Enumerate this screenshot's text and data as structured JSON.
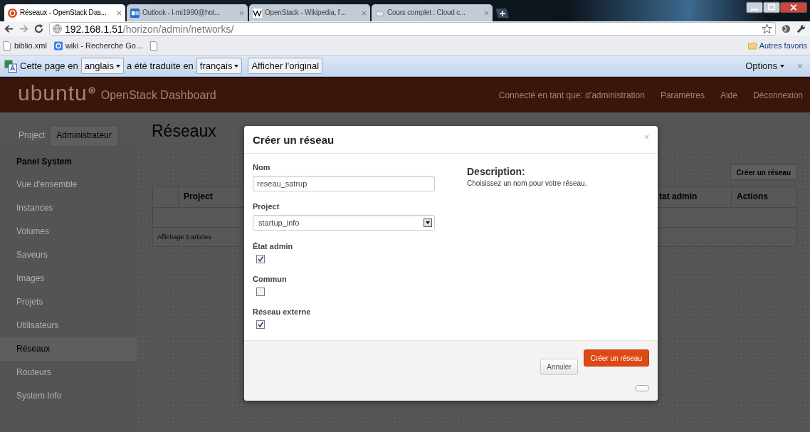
{
  "browser": {
    "tabs": [
      {
        "title": "Réseaux - OpenStack Das...",
        "selected": true
      },
      {
        "title": "Outlook - l-mi1990@hot...",
        "selected": false
      },
      {
        "title": "OpenStack - Wikipedia, l'...",
        "selected": false
      },
      {
        "title": "Cours complet : Cloud c...",
        "selected": false
      }
    ],
    "url_host": "192.168.1.51",
    "url_path": "/horizon/admin/networks/",
    "bookmarks": [
      {
        "label": "biblio.xml"
      },
      {
        "label": "wiki - Recherche Go..."
      }
    ],
    "other_bookmarks": "Autres favoris"
  },
  "translate_bar": {
    "prefix": "Cette page en",
    "source_language": "anglais",
    "middle": "a été traduite en",
    "target_language": "français",
    "show_original": "Afficher l'original",
    "options": "Options"
  },
  "header": {
    "logo": "ubuntu",
    "product": "OpenStack Dashboard",
    "nav": [
      "Connecté en tant que: d'administration",
      "Paramètres",
      "Aide",
      "Déconnexion"
    ]
  },
  "sidebar": {
    "tabs": [
      {
        "label": "Project",
        "selected": false
      },
      {
        "label": "Administrateur",
        "selected": true
      }
    ],
    "heading": "Panel System",
    "items": [
      {
        "label": "Vue d'ensemble",
        "selected": false
      },
      {
        "label": "Instances",
        "selected": false
      },
      {
        "label": "Volumes",
        "selected": false
      },
      {
        "label": "Saveurs",
        "selected": false
      },
      {
        "label": "Images",
        "selected": false
      },
      {
        "label": "Projets",
        "selected": false
      },
      {
        "label": "Utilisateurs",
        "selected": false
      },
      {
        "label": "Réseaux",
        "selected": true
      },
      {
        "label": "Routeurs",
        "selected": false
      },
      {
        "label": "System Info",
        "selected": false
      }
    ]
  },
  "page": {
    "title": "Réseaux",
    "create_button": "Créer un réseau",
    "table": {
      "columns": [
        "Project",
        "tat admin",
        "Actions"
      ],
      "footer": "Affichage 0 articles"
    }
  },
  "modal": {
    "title": "Créer un réseau",
    "fields": [
      {
        "kind": "text",
        "label": "Nom",
        "value": "reseau_satrup"
      },
      {
        "kind": "select",
        "label": "Project",
        "value": "startup_info"
      },
      {
        "kind": "checkbox",
        "label": "État admin",
        "checked": true
      },
      {
        "kind": "checkbox",
        "label": "Commun",
        "checked": false
      },
      {
        "kind": "checkbox",
        "label": "Réseau externe",
        "checked": true
      }
    ],
    "description_title": "Description:",
    "description": "Choisissez un nom pour votre réseau.",
    "cancel": "Annuler",
    "submit": "Créer un réseau"
  }
}
